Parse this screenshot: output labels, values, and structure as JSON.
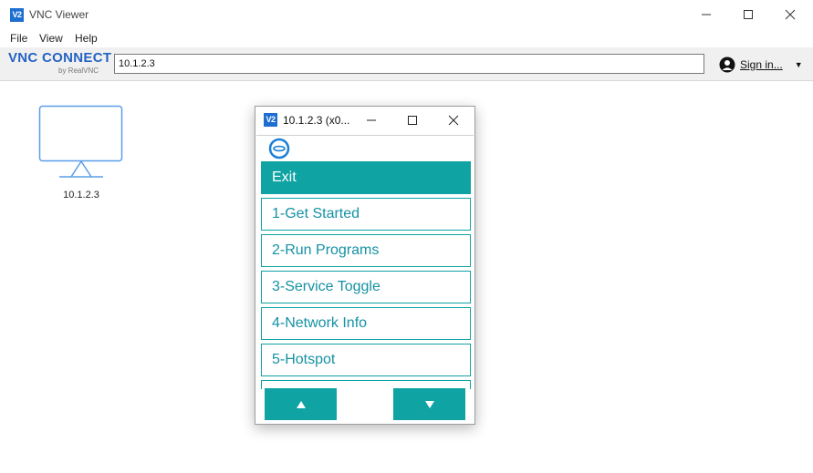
{
  "window": {
    "title": "VNC Viewer",
    "logo_text": "V2"
  },
  "menu": {
    "items": [
      "File",
      "View",
      "Help"
    ]
  },
  "toolbar": {
    "brand_main": "VNC CONNECT",
    "brand_sub": "by RealVNC",
    "address_value": "10.1.2.3",
    "signin_label": "Sign in..."
  },
  "tiles": [
    {
      "label": "10.1.2.3",
      "icon": "monitor-icon"
    }
  ],
  "child_window": {
    "title": "10.1.2.3 (x0...",
    "logo_text": "V2",
    "menu_items": [
      "Exit",
      "1-Get Started",
      "2-Run Programs",
      "3-Service Toggle",
      "4-Network Info",
      "5-Hotspot"
    ],
    "active_item": "Exit",
    "nav_up_icon": "arrow-up-icon",
    "nav_down_icon": "arrow-down-icon"
  },
  "colors": {
    "accent": "#0fa3a3",
    "brand_blue": "#2563c4",
    "menu_text": "#1592a3"
  }
}
